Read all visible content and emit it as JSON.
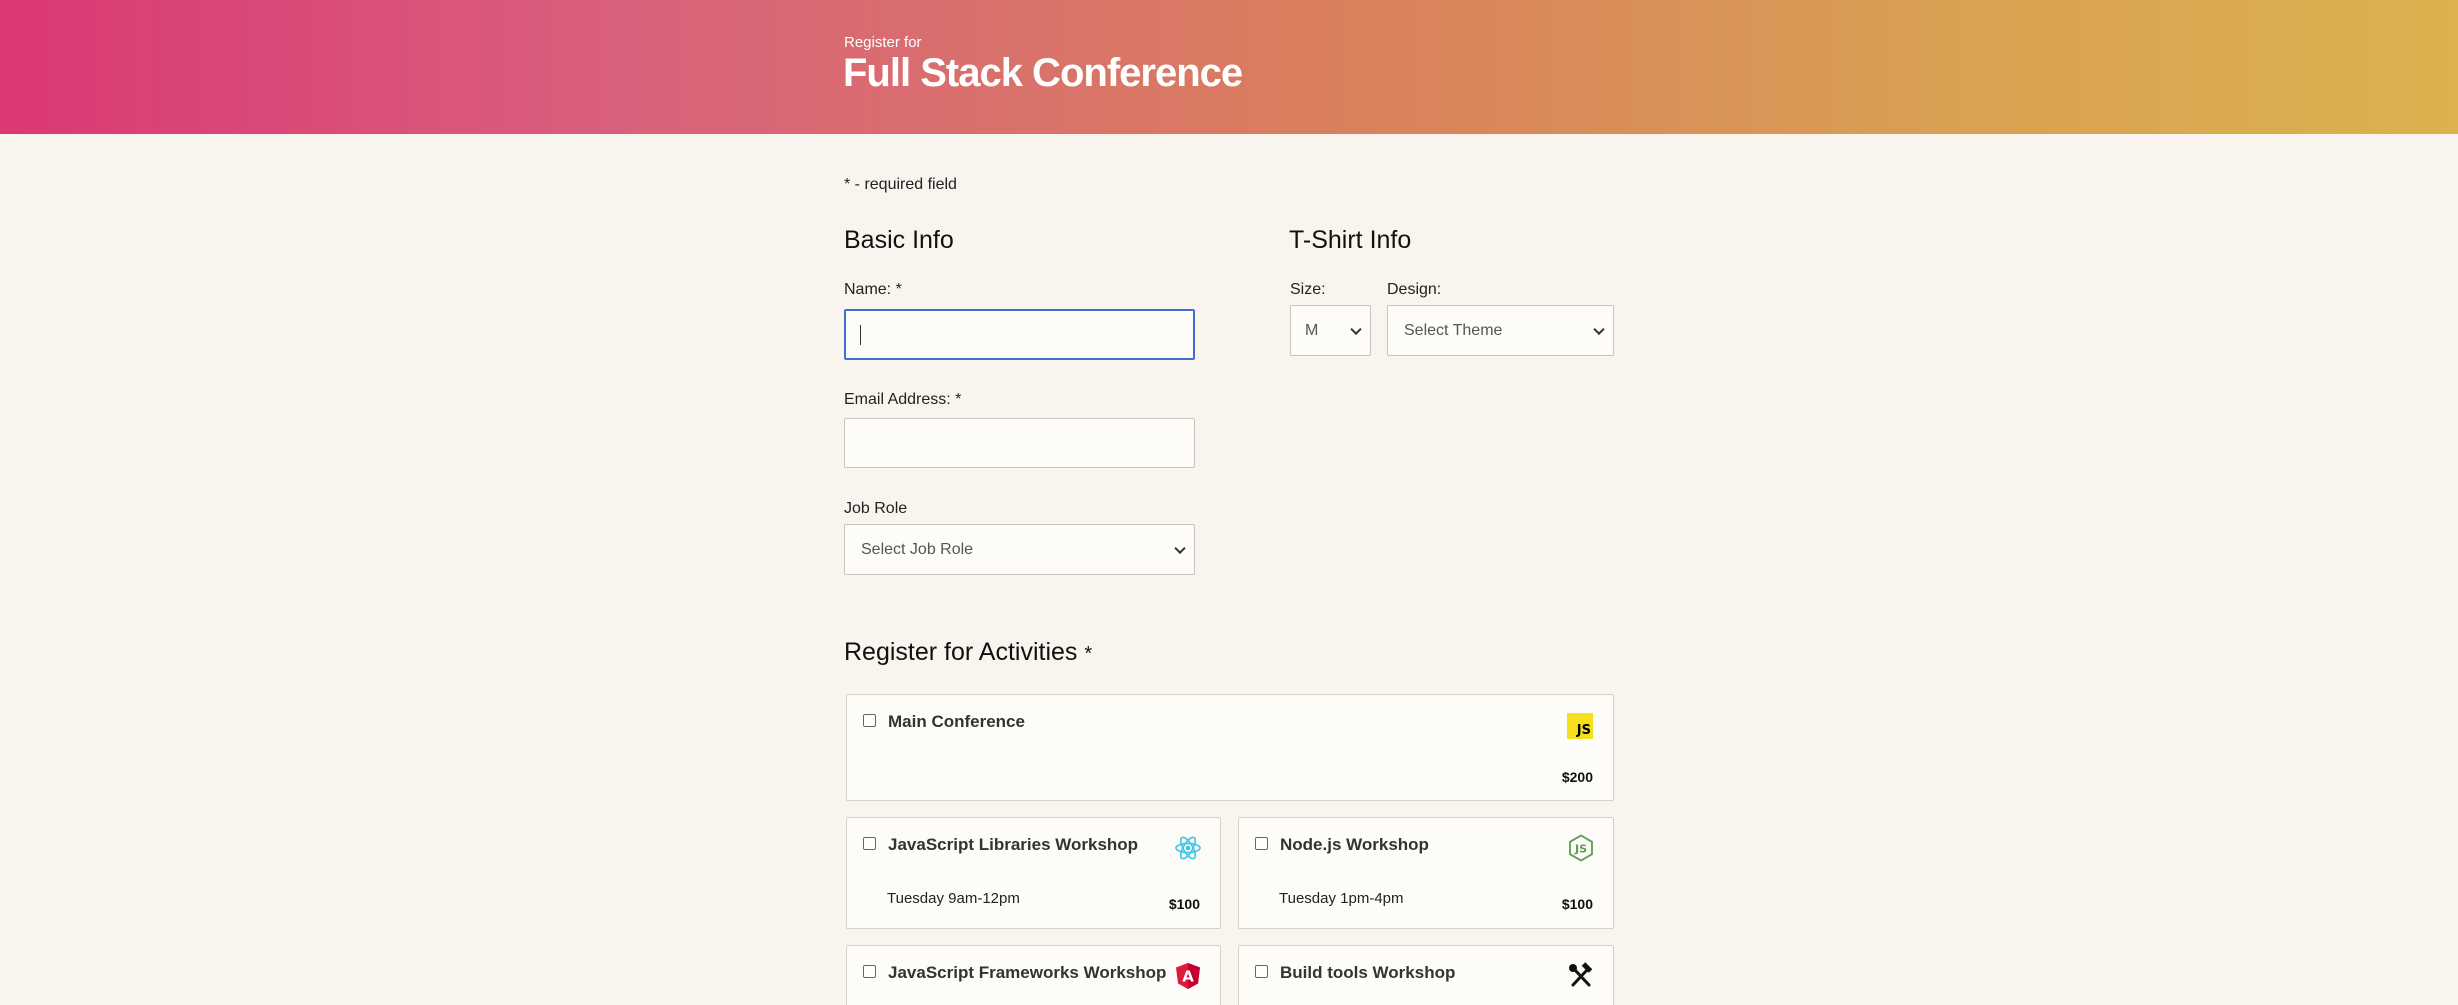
{
  "header": {
    "pre": "Register for",
    "title": "Full Stack Conference"
  },
  "note": "* - required field",
  "basic_info": {
    "title": "Basic Info",
    "name_label": "Name: *",
    "name_value": "",
    "email_label": "Email Address: *",
    "email_value": "",
    "job_label": "Job Role",
    "job_selected": "Select Job Role"
  },
  "tshirt": {
    "title": "T-Shirt Info",
    "size_label": "Size:",
    "size_selected": "M",
    "design_label": "Design:",
    "design_selected": "Select Theme"
  },
  "activities": {
    "title": "Register for Activities",
    "required_mark": "*",
    "items": [
      {
        "name": "Main Conference",
        "time": "",
        "price": "$200",
        "icon": "js-icon"
      },
      {
        "name": "JavaScript Libraries Workshop",
        "time": "Tuesday 9am-12pm",
        "price": "$100",
        "icon": "react-icon"
      },
      {
        "name": "Node.js Workshop",
        "time": "Tuesday 1pm-4pm",
        "price": "$100",
        "icon": "nodejs-icon"
      },
      {
        "name": "JavaScript Frameworks Workshop",
        "time": "",
        "price": "",
        "icon": "angular-icon"
      },
      {
        "name": "Build tools Workshop",
        "time": "",
        "price": "",
        "icon": "tools-icon"
      }
    ]
  },
  "colors": {
    "header_start": "#db3874",
    "header_end": "#dbb24e",
    "background": "#f9f5ee",
    "focus": "#3f6fd4"
  }
}
